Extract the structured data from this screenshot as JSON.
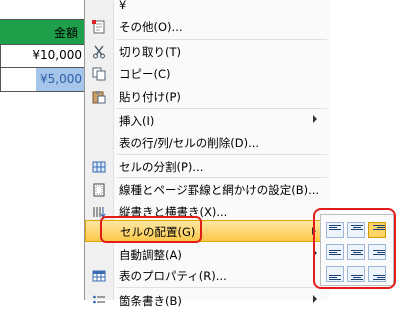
{
  "table": {
    "header": "金額",
    "rows": [
      "¥10,000",
      "¥5,000"
    ]
  },
  "menu": {
    "items": [
      {
        "label": "¥",
        "icon": ""
      },
      {
        "label": "その他(O)...",
        "icon": "symbol-insert-icon"
      },
      {
        "label": "切り取り(T)",
        "icon": "cut-icon"
      },
      {
        "label": "コピー(C)",
        "icon": "copy-icon"
      },
      {
        "label": "貼り付け(P)",
        "icon": "paste-icon"
      },
      {
        "label": "挿入(I)",
        "icon": "",
        "submenu": true
      },
      {
        "label": "表の行/列/セルの削除(D)...",
        "icon": ""
      },
      {
        "label": "セルの分割(P)...",
        "icon": "split-cells-icon"
      },
      {
        "label": "線種とページ罫線と網かけの設定(B)...",
        "icon": "borders-icon"
      },
      {
        "label": "縦書きと横書き(X)...",
        "icon": "text-direction-icon"
      },
      {
        "label": "セルの配置(G)",
        "icon": "",
        "submenu": true,
        "highlighted": true
      },
      {
        "label": "自動調整(A)",
        "icon": "",
        "submenu": true
      },
      {
        "label": "表のプロパティ(R)...",
        "icon": "table-properties-icon"
      },
      {
        "label": "箇条書き(B)",
        "icon": "bullets-icon",
        "submenu": true
      }
    ]
  },
  "alignment_submenu": {
    "options": [
      "top-left",
      "top-center",
      "top-right",
      "middle-left",
      "middle-center",
      "middle-right",
      "bottom-left",
      "bottom-center",
      "bottom-right"
    ],
    "selected": "top-right"
  },
  "colors": {
    "header_green": "#1ea04a",
    "highlight": "#fcc84a",
    "annotation_red": "#e21b1b",
    "selection_blue": "#a5c5ea"
  }
}
